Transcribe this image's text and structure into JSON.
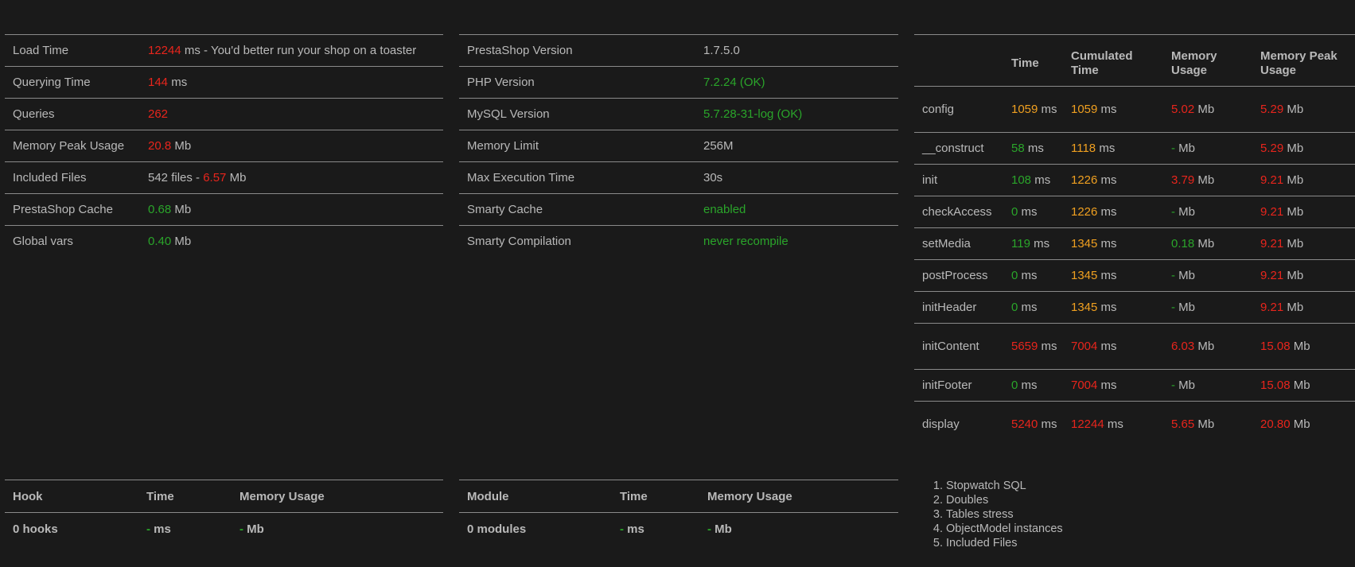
{
  "load": {
    "rows": [
      {
        "label": "Load Time",
        "value": "12244",
        "value_color": "red",
        "suffix": " ms - You'd better run your shop on a toaster"
      },
      {
        "label": "Querying Time",
        "value": "144",
        "value_color": "red",
        "suffix": " ms"
      },
      {
        "label": "Queries",
        "value": "262",
        "value_color": "red",
        "suffix": ""
      },
      {
        "label": "Memory Peak Usage",
        "value": "20.8",
        "value_color": "red",
        "suffix": " Mb"
      },
      {
        "label": "Included Files",
        "prefix": "542 files - ",
        "value": "6.57",
        "value_color": "red",
        "suffix": " Mb"
      },
      {
        "label": "PrestaShop Cache",
        "value": "0.68",
        "value_color": "green",
        "suffix": " Mb"
      },
      {
        "label": "Global vars",
        "value": "0.40",
        "value_color": "green",
        "suffix": " Mb"
      }
    ]
  },
  "environment": {
    "rows": [
      {
        "label": "PrestaShop Version",
        "value": "1.7.5.0",
        "value_color": "plain"
      },
      {
        "label": "PHP Version",
        "value": "7.2.24 (OK)",
        "value_color": "green"
      },
      {
        "label": "MySQL Version",
        "value": "5.7.28-31-log (OK)",
        "value_color": "green"
      },
      {
        "label": "Memory Limit",
        "value": "256M",
        "value_color": "plain"
      },
      {
        "label": "Max Execution Time",
        "value": "30s",
        "value_color": "plain"
      },
      {
        "label": "Smarty Cache",
        "value": "enabled",
        "value_color": "green"
      },
      {
        "label": "Smarty Compilation",
        "value": "never recompile",
        "value_color": "green"
      }
    ]
  },
  "controller": {
    "headers": [
      "",
      "Time",
      "Cumulated Time",
      "Memory Usage",
      "Memory Peak Usage"
    ],
    "rows": [
      {
        "name": "config",
        "time": "1059",
        "time_c": "orange",
        "cum": "1059",
        "cum_c": "orange",
        "mem": "5.02",
        "mem_c": "red",
        "peak": "5.29",
        "peak_c": "red",
        "tall": true
      },
      {
        "name": "__construct",
        "time": "58",
        "time_c": "green",
        "cum": "1118",
        "cum_c": "orange",
        "mem": "-",
        "mem_c": "green",
        "peak": "5.29",
        "peak_c": "red",
        "tall": false
      },
      {
        "name": "init",
        "time": "108",
        "time_c": "green",
        "cum": "1226",
        "cum_c": "orange",
        "mem": "3.79",
        "mem_c": "red",
        "peak": "9.21",
        "peak_c": "red",
        "tall": false
      },
      {
        "name": "checkAccess",
        "time": "0",
        "time_c": "green",
        "cum": "1226",
        "cum_c": "orange",
        "mem": "-",
        "mem_c": "green",
        "peak": "9.21",
        "peak_c": "red",
        "tall": false
      },
      {
        "name": "setMedia",
        "time": "119",
        "time_c": "green",
        "cum": "1345",
        "cum_c": "orange",
        "mem": "0.18",
        "mem_c": "green",
        "peak": "9.21",
        "peak_c": "red",
        "tall": false
      },
      {
        "name": "postProcess",
        "time": "0",
        "time_c": "green",
        "cum": "1345",
        "cum_c": "orange",
        "mem": "-",
        "mem_c": "green",
        "peak": "9.21",
        "peak_c": "red",
        "tall": false
      },
      {
        "name": "initHeader",
        "time": "0",
        "time_c": "green",
        "cum": "1345",
        "cum_c": "orange",
        "mem": "-",
        "mem_c": "green",
        "peak": "9.21",
        "peak_c": "red",
        "tall": false
      },
      {
        "name": "initContent",
        "time": "5659",
        "time_c": "red",
        "cum": "7004",
        "cum_c": "red",
        "mem": "6.03",
        "mem_c": "red",
        "peak": "15.08",
        "peak_c": "red",
        "tall": true
      },
      {
        "name": "initFooter",
        "time": "0",
        "time_c": "green",
        "cum": "7004",
        "cum_c": "red",
        "mem": "-",
        "mem_c": "green",
        "peak": "15.08",
        "peak_c": "red",
        "tall": false
      },
      {
        "name": "display",
        "time": "5240",
        "time_c": "red",
        "cum": "12244",
        "cum_c": "red",
        "mem": "5.65",
        "mem_c": "red",
        "peak": "20.80",
        "peak_c": "red",
        "tall": true
      }
    ],
    "ms_unit": "ms",
    "mb_unit": "Mb"
  },
  "hooks": {
    "headers": [
      "Hook",
      "Time",
      "Memory Usage"
    ],
    "total_label": "0 hooks",
    "time_value": "-",
    "time_unit": " ms",
    "mem_value": "-",
    "mem_unit": " Mb"
  },
  "modules": {
    "headers": [
      "Module",
      "Time",
      "Memory Usage"
    ],
    "total_label": "0 modules",
    "time_value": "-",
    "time_unit": " ms",
    "mem_value": "-",
    "mem_unit": " Mb"
  },
  "links": [
    "Stopwatch SQL",
    "Doubles",
    "Tables stress",
    "ObjectModel instances",
    "Included Files"
  ],
  "colors": {
    "red": "#e8251c",
    "green": "#2aa52a",
    "orange": "#f0a020",
    "plain": "#b9b9b9",
    "background": "#1a1a1a"
  }
}
